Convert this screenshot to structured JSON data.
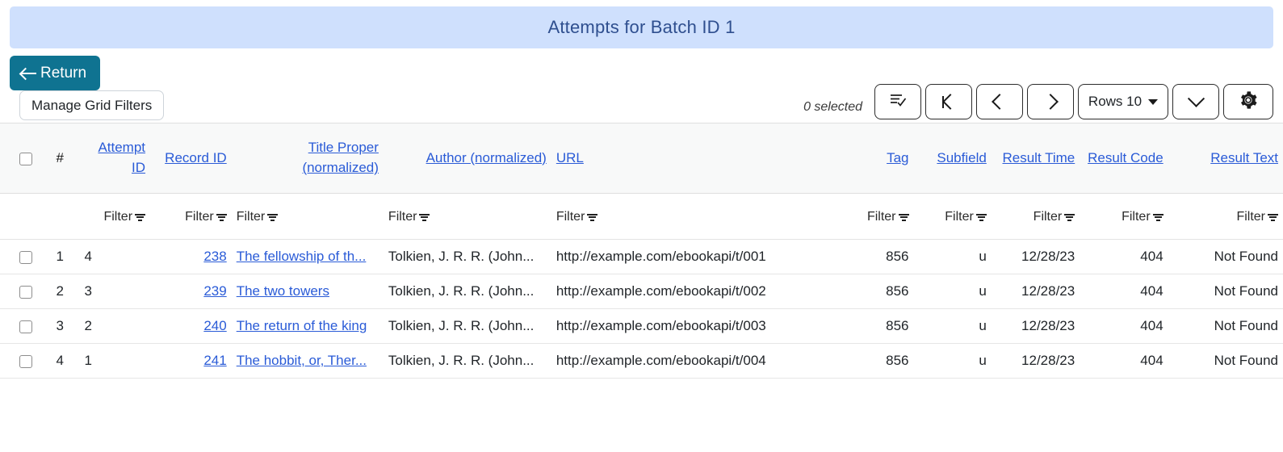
{
  "banner": {
    "title": "Attempts for Batch ID 1"
  },
  "toolbar": {
    "return_label": "Return",
    "manage_grid_filters_label": "Manage Grid Filters",
    "selected_count": "0 selected",
    "select_actions_icon": "list-check-icon",
    "first_page_icon": "first-page-icon",
    "prev_page_icon": "previous-page-icon",
    "next_page_icon": "next-page-icon",
    "rows_label": "Rows 10",
    "expand_icon": "chevron-down-icon",
    "settings_icon": "gear-icon"
  },
  "table": {
    "row_number_header": "#",
    "filter_label": "Filter",
    "columns": [
      {
        "label": "Attempt ID",
        "align": "right"
      },
      {
        "label": "Record ID",
        "align": "right"
      },
      {
        "label": "Title Proper (normalized)",
        "align": "right"
      },
      {
        "label": "Author (normalized)",
        "align": "right"
      },
      {
        "label": "URL",
        "align": "left"
      },
      {
        "label": "Tag",
        "align": "right"
      },
      {
        "label": "Subfield",
        "align": "right"
      },
      {
        "label": "Result Time",
        "align": "right"
      },
      {
        "label": "Result Code",
        "align": "right"
      },
      {
        "label": "Result Text",
        "align": "right"
      }
    ],
    "rows": [
      {
        "num": "1",
        "attempt_id": "4",
        "record_id": "238",
        "title": "The fellowship of th...",
        "author": "Tolkien, J. R. R. (John...",
        "url": "http://example.com/ebookapi/t/001",
        "tag": "856",
        "subfield": "u",
        "result_time": "12/28/23",
        "result_code": "404",
        "result_text": "Not Found"
      },
      {
        "num": "2",
        "attempt_id": "3",
        "record_id": "239",
        "title": "The two towers",
        "author": "Tolkien, J. R. R. (John...",
        "url": "http://example.com/ebookapi/t/002",
        "tag": "856",
        "subfield": "u",
        "result_time": "12/28/23",
        "result_code": "404",
        "result_text": "Not Found"
      },
      {
        "num": "3",
        "attempt_id": "2",
        "record_id": "240",
        "title": "The return of the king",
        "author": "Tolkien, J. R. R. (John...",
        "url": "http://example.com/ebookapi/t/003",
        "tag": "856",
        "subfield": "u",
        "result_time": "12/28/23",
        "result_code": "404",
        "result_text": "Not Found"
      },
      {
        "num": "4",
        "attempt_id": "1",
        "record_id": "241",
        "title": "The hobbit, or, Ther...",
        "author": "Tolkien, J. R. R. (John...",
        "url": "http://example.com/ebookapi/t/004",
        "tag": "856",
        "subfield": "u",
        "result_time": "12/28/23",
        "result_code": "404",
        "result_text": "Not Found"
      }
    ]
  },
  "colors": {
    "banner_bg": "#cfe0fd",
    "banner_text": "#2f4f8f",
    "return_bg": "#0f7391",
    "link": "#2a5bd7"
  }
}
